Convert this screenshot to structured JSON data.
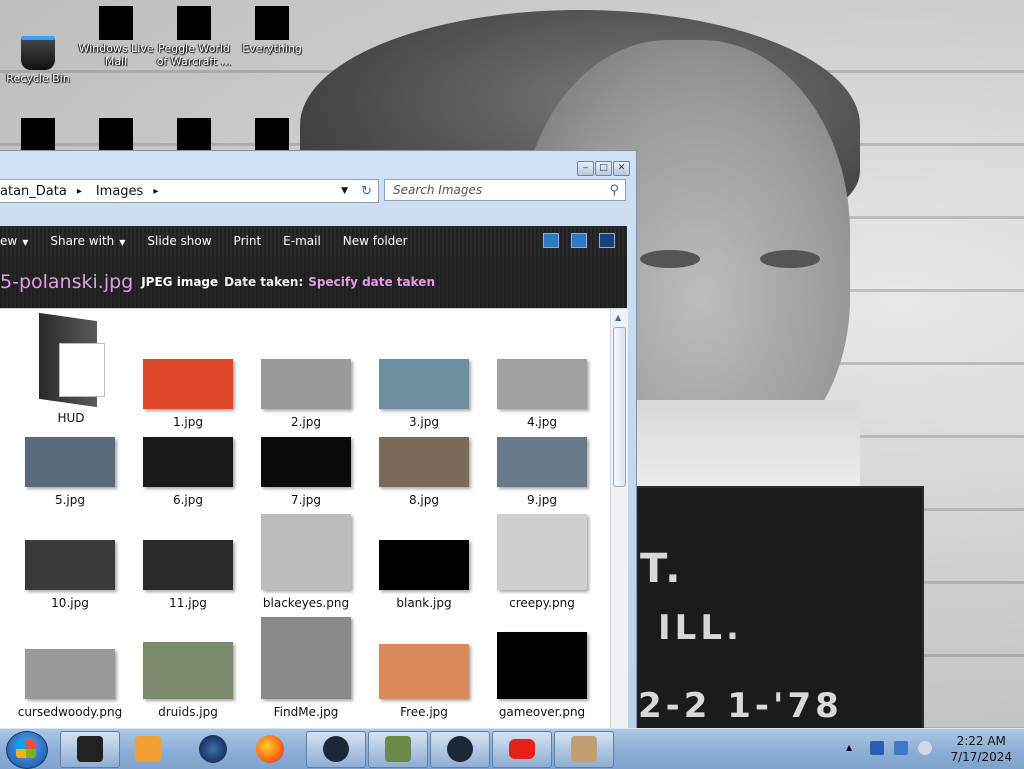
{
  "desktop": {
    "icons": [
      {
        "label": "Recycle Bin",
        "icon": "recycle-bin-icon"
      },
      {
        "label": "Windows Live Mail",
        "icon": "mail-icon"
      },
      {
        "label": "Peggle World of Warcraft ...",
        "icon": "game-icon"
      },
      {
        "label": "Everything",
        "icon": "search-app-icon"
      }
    ]
  },
  "wallpaper": {
    "board_lines": [
      "T.",
      "ILL.",
      "2-2 1-'78"
    ]
  },
  "explorer": {
    "breadcrumb": [
      "atan_Data",
      "Images"
    ],
    "search_placeholder": "Search Images",
    "toolbar": {
      "view": "ew",
      "share": "Share with",
      "slideshow": "Slide show",
      "print": "Print",
      "email": "E-mail",
      "new_folder": "New folder"
    },
    "details": {
      "filename": "5-polanski.jpg",
      "filetype": "JPEG image",
      "date_label": "Date taken:",
      "date_value": "Specify date taken"
    },
    "items": [
      {
        "label": "HUD",
        "kind": "folder"
      },
      {
        "label": "1.jpg",
        "color": "#e0482a"
      },
      {
        "label": "2.jpg",
        "color": "#9a9a9a"
      },
      {
        "label": "3.jpg",
        "color": "#6e8fa0"
      },
      {
        "label": "4.jpg",
        "color": "#a0a0a0"
      },
      {
        "label": "5.jpg",
        "color": "#5a6a7a"
      },
      {
        "label": "6.jpg",
        "color": "#1a1a1a"
      },
      {
        "label": "7.jpg",
        "color": "#0a0a0a"
      },
      {
        "label": "8.jpg",
        "color": "#7a6a5a"
      },
      {
        "label": "9.jpg",
        "color": "#6a7a8a"
      },
      {
        "label": "10.jpg",
        "color": "#3a3a3a"
      },
      {
        "label": "11.jpg",
        "color": "#2a2a2a"
      },
      {
        "label": "blackeyes.png",
        "color": "#bdbdbd"
      },
      {
        "label": "blank.jpg",
        "color": "#000000"
      },
      {
        "label": "creepy.png",
        "color": "#cfcfcf"
      },
      {
        "label": "cursedwoody.png",
        "color": "#9a9a9a"
      },
      {
        "label": "druids.jpg",
        "color": "#7a8a6a"
      },
      {
        "label": "FindMe.jpg",
        "color": "#8a8a8a"
      },
      {
        "label": "Free.jpg",
        "color": "#d88a5a"
      },
      {
        "label": "gameover.png",
        "color": "#000000"
      }
    ]
  },
  "taskbar": {
    "time": "2:22 AM",
    "date": "7/17/2024"
  }
}
